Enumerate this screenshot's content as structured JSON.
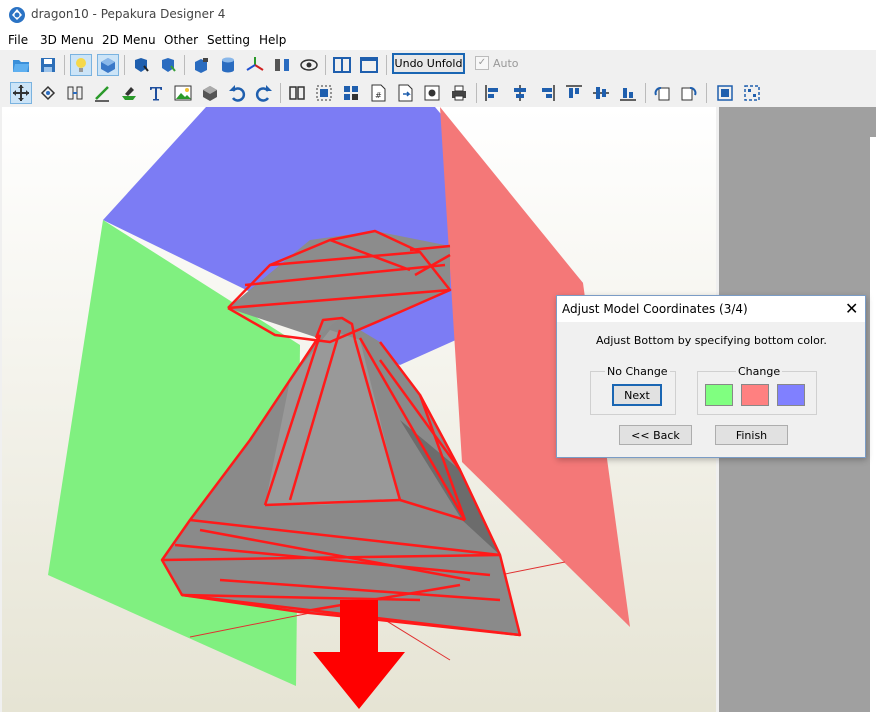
{
  "window": {
    "title": "dragon10 - Pepakura Designer 4"
  },
  "menu": [
    "File",
    "3D Menu",
    "2D Menu",
    "Other",
    "Setting",
    "Help"
  ],
  "toolbar": {
    "undo_unfold_label": "Undo Unfold",
    "auto_label": "Auto",
    "auto_checked": true
  },
  "dialog": {
    "title": "Adjust Model Coordinates (3/4)",
    "close_glyph": "✕",
    "message": "Adjust Bottom by specifying bottom color.",
    "no_change_label": "No Change",
    "next_label": "Next",
    "change_label": "Change",
    "swatches": [
      {
        "name": "green",
        "color": "#80ff80"
      },
      {
        "name": "red",
        "color": "#ff8080"
      },
      {
        "name": "blue",
        "color": "#8080ff"
      }
    ],
    "back_label": "<< Back",
    "finish_label": "Finish"
  },
  "colors": {
    "plane_blue": "#7c7cf4",
    "plane_green": "#80f080",
    "plane_red": "#f47878",
    "model_gray": "#8c8c8c",
    "wire_red": "#ff1a1a",
    "arrow_red": "#ff0000"
  }
}
